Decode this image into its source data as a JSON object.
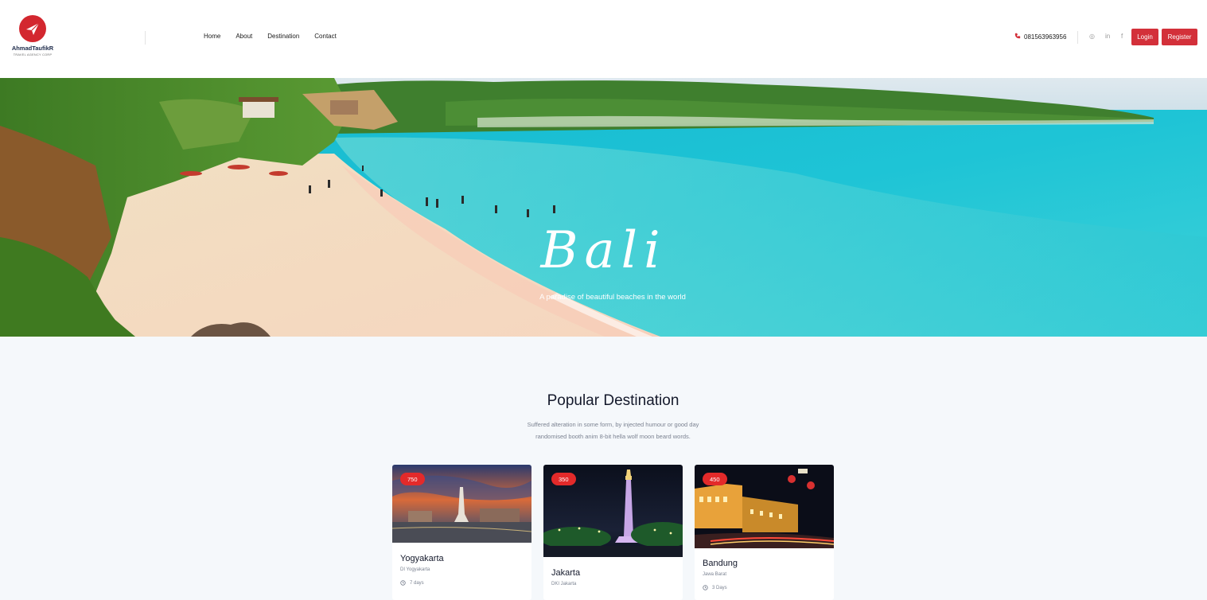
{
  "brand": {
    "name": "AhmadTaufikR",
    "tagline": "TRAVEL AGENCY CORP"
  },
  "nav": [
    {
      "label": "Home"
    },
    {
      "label": "About"
    },
    {
      "label": "Destination"
    },
    {
      "label": "Contact"
    }
  ],
  "contact": {
    "phone": "081563963956"
  },
  "social": [
    {
      "icon": "instagram-icon",
      "glyph": "◎"
    },
    {
      "icon": "linkedin-icon",
      "glyph": "in"
    },
    {
      "icon": "facebook-icon",
      "glyph": "f"
    }
  ],
  "auth": {
    "login_label": "Login",
    "register_label": "Register"
  },
  "hero": {
    "title": "Bali",
    "subtitle": "A paradise of beautiful beaches in the world"
  },
  "section": {
    "title": "Popular Destination",
    "desc_line1": "Suffered alteration in some form, by injected humour or good day",
    "desc_line2": "randomised booth anim 8-bit hella wolf moon beard words."
  },
  "destinations": [
    {
      "badge": "750",
      "name": "Yogyakarta",
      "region": "DI Yogyakarta",
      "duration": "7 days"
    },
    {
      "badge": "350",
      "name": "Jakarta",
      "region": "DKI Jakarta",
      "duration": ""
    },
    {
      "badge": "450",
      "name": "Bandung",
      "region": "Jawa Barat",
      "duration": "3 Days"
    }
  ],
  "colors": {
    "accent": "#d3303a",
    "badge": "#e32a2a",
    "heading": "#14192b",
    "muted": "#7c8392"
  }
}
